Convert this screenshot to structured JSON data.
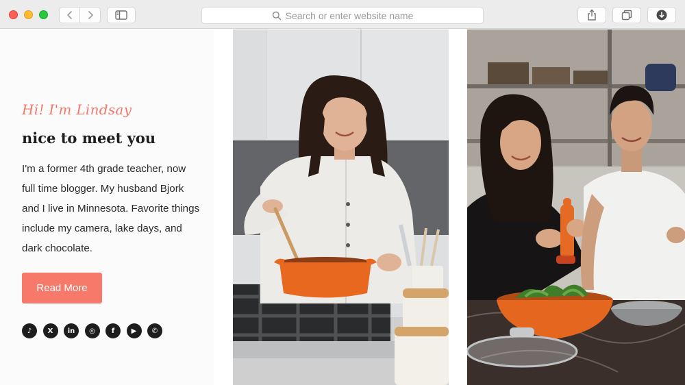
{
  "browser": {
    "address_placeholder": "Search or enter website name",
    "buttons": {
      "back": "chevron-left-icon",
      "forward": "chevron-right-icon",
      "sidebar": "sidebar-icon",
      "share": "share-icon",
      "tabs": "tabs-overview-icon",
      "downloads": "download-icon"
    }
  },
  "intro": {
    "greeting": "Hi! I'm Lindsay",
    "headline": "nice to meet you",
    "bio": "I'm a former 4th grade teacher, now full time blogger. My husband Bjork and I live in Minnesota. Favorite things include my camera, lake days, and dark chocolate.",
    "read_more": "Read More",
    "socials": [
      {
        "name": "tiktok-icon",
        "glyph": "♪"
      },
      {
        "name": "x-icon",
        "glyph": "X"
      },
      {
        "name": "linkedin-icon",
        "glyph": "in"
      },
      {
        "name": "instagram-icon",
        "glyph": "◎"
      },
      {
        "name": "facebook-icon",
        "glyph": "f"
      },
      {
        "name": "youtube-icon",
        "glyph": "▶"
      },
      {
        "name": "whatsapp-icon",
        "glyph": "✆"
      }
    ]
  },
  "colors": {
    "accent": "#f7796a",
    "greeting": "#f0796a",
    "text": "#1d1d1d",
    "pot_orange": "#e8681f"
  },
  "photos": [
    {
      "name": "photo-woman-stirring-pot",
      "description": "woman stirring an orange pot on a gas stove"
    },
    {
      "name": "photo-couple-cooking",
      "description": "couple cooking with a salad bowl and pepper grinder"
    }
  ]
}
